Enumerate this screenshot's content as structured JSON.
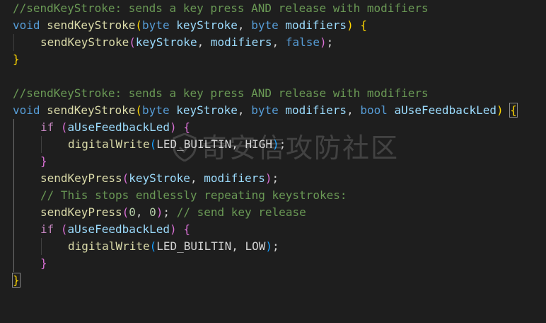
{
  "code": {
    "comment1": "//sendKeyStroke: sends a key press AND release with modifiers",
    "comment2": "//sendKeyStroke: sends a key press AND release with modifiers",
    "comment_stops": "// This stops endlessly repeating keystrokes:",
    "comment_release": "// send key release",
    "kw_void": "void",
    "kw_byte": "byte",
    "kw_bool": "bool",
    "kw_false": "false",
    "kw_if": "if",
    "fn_sendKeyStroke": "sendKeyStroke",
    "fn_sendKeyPress": "sendKeyPress",
    "fn_digitalWrite": "digitalWrite",
    "param_keyStroke": "keyStroke",
    "param_modifiers": "modifiers",
    "param_feedback": "aUseFeedbackLed",
    "const_led": "LED_BUILTIN",
    "const_high": "HIGH",
    "const_low": "LOW",
    "num_zero": "0"
  },
  "watermark": {
    "text": "奇安信攻防社区"
  },
  "colors": {
    "background": "#1e1e1e",
    "comment": "#6a9955",
    "keyword": "#569cd6",
    "control": "#c586c0",
    "function": "#dcdcaa",
    "parameter": "#9cdcfe",
    "number": "#b5cea8",
    "bracket_level1": "#ffd700",
    "bracket_level2": "#da70d6",
    "bracket_level3": "#179fff"
  }
}
